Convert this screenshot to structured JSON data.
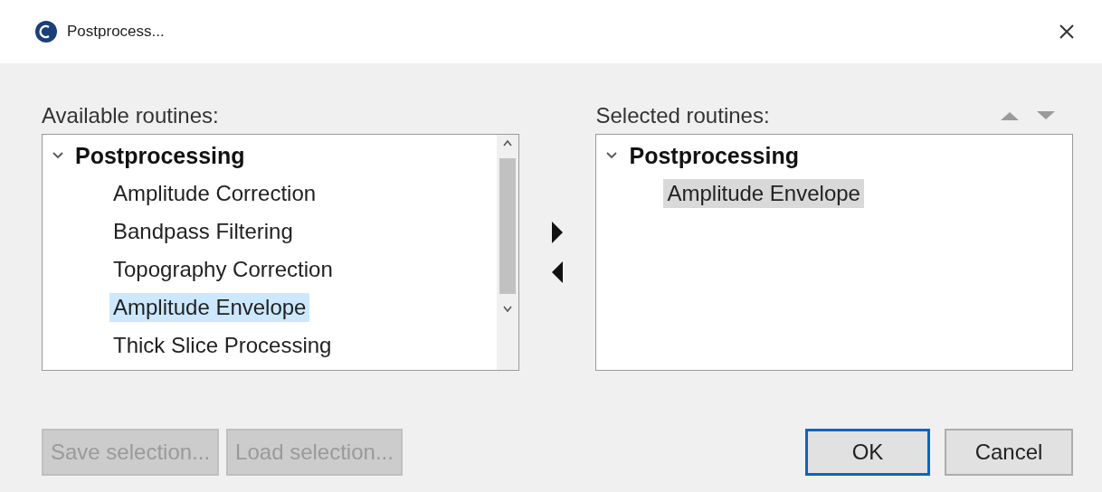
{
  "window": {
    "title": "Postprocess..."
  },
  "available": {
    "label": "Available routines:",
    "focused": true,
    "tree": [
      {
        "label": "Postprocessing",
        "expanded": true,
        "children": [
          {
            "label": "Amplitude Correction",
            "selected": false
          },
          {
            "label": "Bandpass Filtering",
            "selected": false
          },
          {
            "label": "Topography Correction",
            "selected": false
          },
          {
            "label": "Amplitude Envelope",
            "selected": true
          },
          {
            "label": "Thick Slice Processing",
            "selected": false
          }
        ]
      }
    ]
  },
  "selected_routines": {
    "label": "Selected routines:",
    "focused": false,
    "tree": [
      {
        "label": "Postprocessing",
        "expanded": true,
        "children": [
          {
            "label": "Amplitude Envelope",
            "selected": true
          }
        ]
      }
    ]
  },
  "buttons": [
    {
      "label": "Save selection...",
      "disabled": true,
      "default": false
    },
    {
      "label": "Load selection...",
      "disabled": true,
      "default": false
    },
    {
      "label": "OK",
      "disabled": false,
      "default": true
    },
    {
      "label": "Cancel",
      "disabled": false,
      "default": false
    }
  ]
}
